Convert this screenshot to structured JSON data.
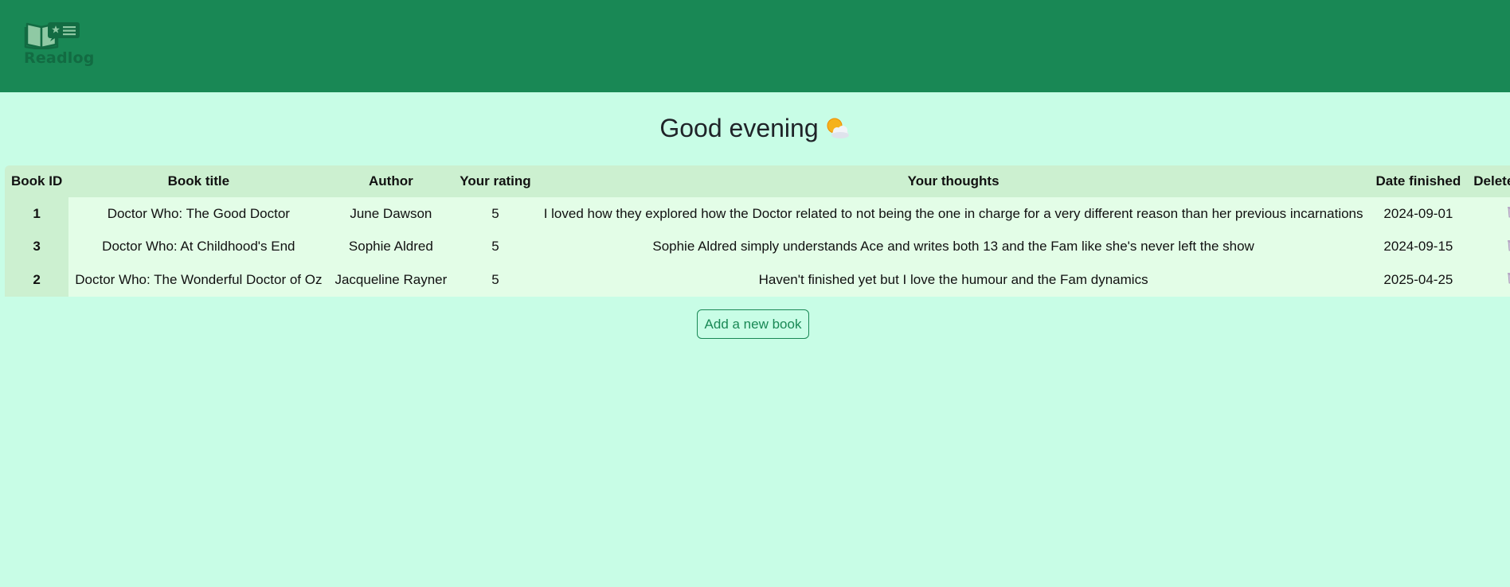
{
  "header": {
    "brand_name": "Readlog",
    "logo_icon": "open-book-list-icon",
    "bg_color": "#198855"
  },
  "greeting": {
    "text": "Good evening",
    "emoji": "sun-behind-cloud-icon"
  },
  "table": {
    "columns": [
      "Book ID",
      "Book title",
      "Author",
      "Your rating",
      "Your thoughts",
      "Date finished",
      "Delete entry"
    ],
    "rows": [
      {
        "id": "1",
        "title": "Doctor Who: The Good Doctor",
        "author": "June Dawson",
        "rating": "5",
        "thoughts": "I loved how they explored how the Doctor related to not being the one in charge for a very different reason than her previous incarnations",
        "date": "2024-09-01"
      },
      {
        "id": "3",
        "title": "Doctor Who: At Childhood's End",
        "author": "Sophie Aldred",
        "rating": "5",
        "thoughts": "Sophie Aldred simply understands Ace and writes both 13 and the Fam like she's never left the show",
        "date": "2024-09-15"
      },
      {
        "id": "2",
        "title": "Doctor Who: The Wonderful Doctor of Oz",
        "author": "Jacqueline Rayner",
        "rating": "5",
        "thoughts": "Haven't finished yet but I love the humour and the Fam dynamics",
        "date": "2025-04-25"
      }
    ],
    "delete_icon": "trash-icon"
  },
  "actions": {
    "add_label": "Add a new book"
  },
  "colors": {
    "page_bg": "#c8fde6",
    "header_cell": "#ccf0d0",
    "body_cell": "#e3fde7",
    "accent": "#198855"
  }
}
